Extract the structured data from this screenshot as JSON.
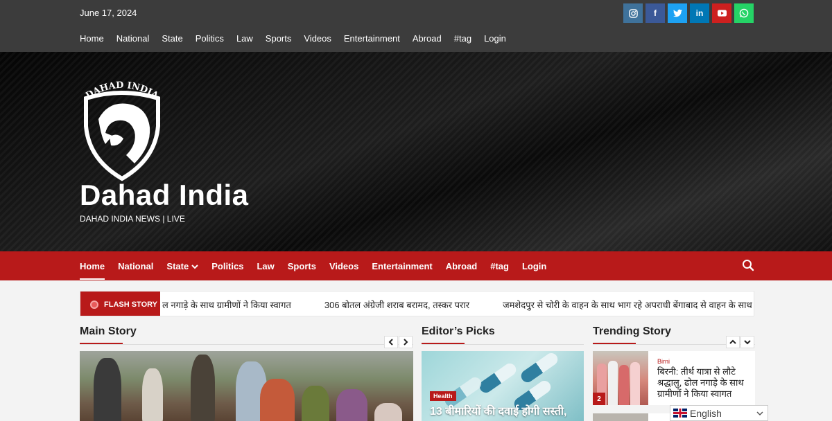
{
  "top": {
    "date": "June 17, 2024",
    "nav": [
      "Home",
      "National",
      "State",
      "Politics",
      "Law",
      "Sports",
      "Videos",
      "Entertainment",
      "Abroad",
      "#tag",
      "Login"
    ],
    "social": [
      {
        "icon": "instagram-icon",
        "glyph": "◎",
        "color": "#3f729b"
      },
      {
        "icon": "facebook-icon",
        "glyph": "f",
        "color": "#3b5998"
      },
      {
        "icon": "twitter-icon",
        "glyph": "t",
        "color": "#1da1f2"
      },
      {
        "icon": "linkedin-icon",
        "glyph": "in",
        "color": "#0077b5"
      },
      {
        "icon": "youtube-icon",
        "glyph": "▶",
        "color": "#cd201f"
      },
      {
        "icon": "whatsapp-icon",
        "glyph": "✆",
        "color": "#25d366"
      }
    ]
  },
  "banner": {
    "logo_text": "DAHAD INDIA",
    "title": "Dahad India",
    "tagline": "DAHAD INDIA NEWS | LIVE"
  },
  "main_nav": {
    "items": [
      "Home",
      "National",
      "State",
      "Politics",
      "Law",
      "Sports",
      "Videos",
      "Entertainment",
      "Abroad",
      "#tag",
      "Login"
    ],
    "active": "Home",
    "state_caret": "⌄"
  },
  "flash": {
    "label": "FLASH STORY",
    "items": [
      "ल नगाड़े के साथ ग्रामीणों ने किया स्वागत",
      "306 बोतल अंग्रेजी शराब बरामद, तस्कर परार",
      "जमशेदपुर से चोरी के वाहन के साथ भाग रहे अपराधी बेंगाबाद से वाहन के साथ ि"
    ]
  },
  "sections": {
    "main_story": "Main Story",
    "editors_picks": "Editor’s Picks",
    "trending": "Trending Story"
  },
  "editor": {
    "badge": "Health",
    "headline": "13 बीमारियों की दवाई होगी सस्ती,"
  },
  "trending": {
    "number": "2",
    "category": "Birni",
    "title": "बिरनी: तीर्थ यात्रा से लौटे श्रद्धालु, ढोल नगाड़े के साथ ग्रामीणों ने किया स्वागत"
  },
  "language": {
    "label": "English",
    "flag_icon": "uk-flag-icon"
  },
  "colors": {
    "accent": "#b81a1a",
    "topbar": "#3c3c3c"
  }
}
